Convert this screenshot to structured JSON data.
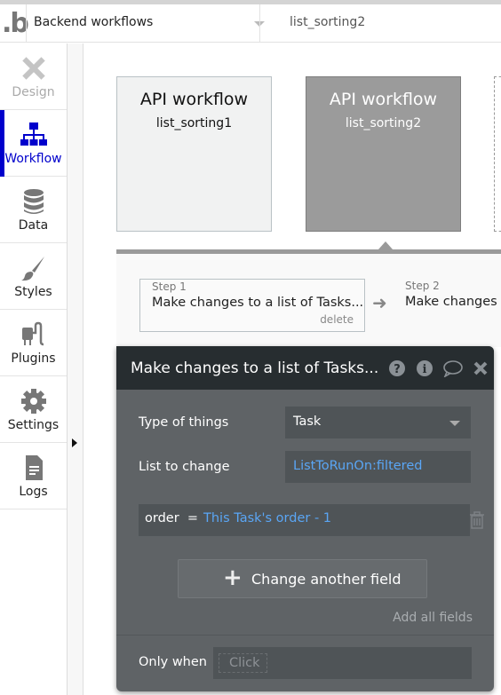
{
  "header": {
    "logo": ".b",
    "page_selector": "Backend workflows",
    "workflow_name": "list_sorting2"
  },
  "sidebar": {
    "items": [
      {
        "label": "Design",
        "icon": "design-icon",
        "state": "disabled"
      },
      {
        "label": "Workflow",
        "icon": "workflow-icon",
        "state": "active"
      },
      {
        "label": "Data",
        "icon": "database-icon",
        "state": "normal"
      },
      {
        "label": "Styles",
        "icon": "brush-icon",
        "state": "normal"
      },
      {
        "label": "Plugins",
        "icon": "plug-icon",
        "state": "normal"
      },
      {
        "label": "Settings",
        "icon": "gear-icon",
        "state": "normal"
      },
      {
        "label": "Logs",
        "icon": "document-icon",
        "state": "normal"
      }
    ]
  },
  "events": [
    {
      "title": "API workflow",
      "name": "list_sorting1",
      "selected": false
    },
    {
      "title": "API workflow",
      "name": "list_sorting2",
      "selected": true
    }
  ],
  "steps": [
    {
      "label": "Step 1",
      "title": "Make changes to a list of Tasks...",
      "delete": "delete"
    },
    {
      "label": "Step 2",
      "title": "Make changes t"
    }
  ],
  "editor": {
    "title": "Make changes to a list of Tasks...",
    "type_label": "Type of things",
    "type_value": "Task",
    "list_label": "List to change",
    "list_value": "ListToRunOn:filtered",
    "change_field": "order  =",
    "change_value": "This Task's order - 1",
    "add_button": "Change another field",
    "add_all": "Add all fields",
    "only_when_label": "Only when",
    "only_when_placeholder": "Click"
  },
  "colors": {
    "accent": "#0000cc",
    "link": "#5aa6f5",
    "editor_bg": "#5f6366",
    "editor_header": "#272d30"
  }
}
